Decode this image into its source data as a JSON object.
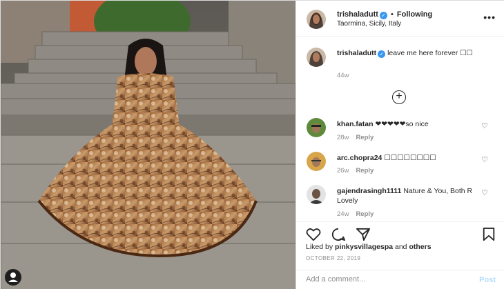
{
  "header": {
    "username": "trishaladutt",
    "separator": "•",
    "follow_status": "Following",
    "location": "Taormina, Sicily, Italy",
    "more_label": "•••"
  },
  "caption": {
    "username": "trishaladutt",
    "text": "leave me here forever ☐☐",
    "time": "44w"
  },
  "load_more_label": "+",
  "comments": [
    {
      "username": "khan.fatan",
      "text": "❤❤❤❤❤so nice",
      "time": "28w",
      "reply": "Reply"
    },
    {
      "username": "arc.chopra24",
      "text": "☐☐☐☐☐☐☐☐",
      "time": "26w",
      "reply": "Reply"
    },
    {
      "username": "gajendrasingh1111",
      "text": "Nature & You, Both R Lovely",
      "time": "24w",
      "reply": "Reply"
    }
  ],
  "heart_glyph": "♡",
  "likes": {
    "prefix": "Liked by",
    "user": "pinkysvillagespa",
    "joiner": "and",
    "others": "others"
  },
  "date": "October 22, 2019",
  "add_comment": {
    "placeholder": "Add a comment...",
    "post_label": "Post"
  },
  "colors": {
    "verified": "#3897f0",
    "post_disabled": "#b2dffc",
    "muted": "#8e8e8e",
    "text": "#262626"
  }
}
